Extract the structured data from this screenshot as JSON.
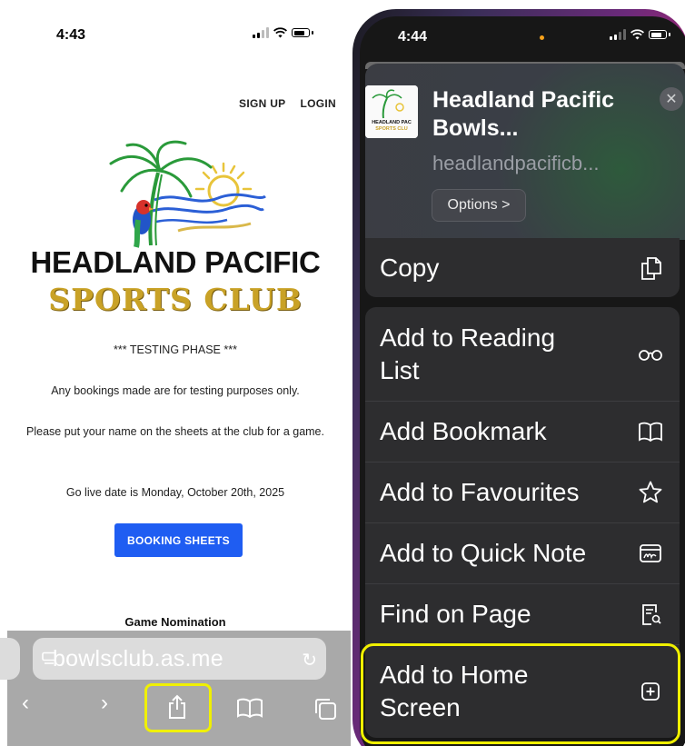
{
  "left_phone": {
    "status_time": "4:43",
    "nav_links": [
      "SIGN UP",
      "LOGIN"
    ],
    "brand": {
      "line1": "HEADLAND PACIFIC",
      "line2": "SPORTS CLUB"
    },
    "notice": {
      "testing": "*** TESTING PHASE ***",
      "testing_purposes": "Any bookings made are for testing purposes only.",
      "sheets": "Please put your name on the sheets at the club for a game.",
      "go_live": "Go live date is Monday, October 20th, 2025"
    },
    "booking_button": "BOOKING SHEETS",
    "section_heading": "Game Nomination",
    "browser": {
      "url": "bowlsclub.as.me",
      "icons": [
        "page-icon",
        "reload-icon",
        "back-icon",
        "forward-icon",
        "share-icon",
        "bookmarks-icon",
        "tabs-icon"
      ]
    }
  },
  "right_phone": {
    "status_time": "4:44",
    "share_sheet": {
      "site_title": "Headland Pacific Bowls...",
      "site_url": "headlandpacificb...",
      "options_label": "Options >",
      "thumbnail_text": "HEADLAND PAC SPORTS CLUB",
      "groups": [
        [
          {
            "label": "Copy",
            "icon": "copy-icon"
          }
        ],
        [
          {
            "label": "Add to Reading List",
            "icon": "glasses-icon"
          },
          {
            "label": "Add Bookmark",
            "icon": "book-icon"
          },
          {
            "label": "Add to Favourites",
            "icon": "star-icon"
          },
          {
            "label": "Add to Quick Note",
            "icon": "quick-note-icon"
          },
          {
            "label": "Find on Page",
            "icon": "find-on-page-icon"
          },
          {
            "label": "Add to Home Screen",
            "icon": "plus-square-icon"
          }
        ]
      ]
    }
  },
  "highlight_color": "#f0f000",
  "accent_button_color": "#1f5df2"
}
